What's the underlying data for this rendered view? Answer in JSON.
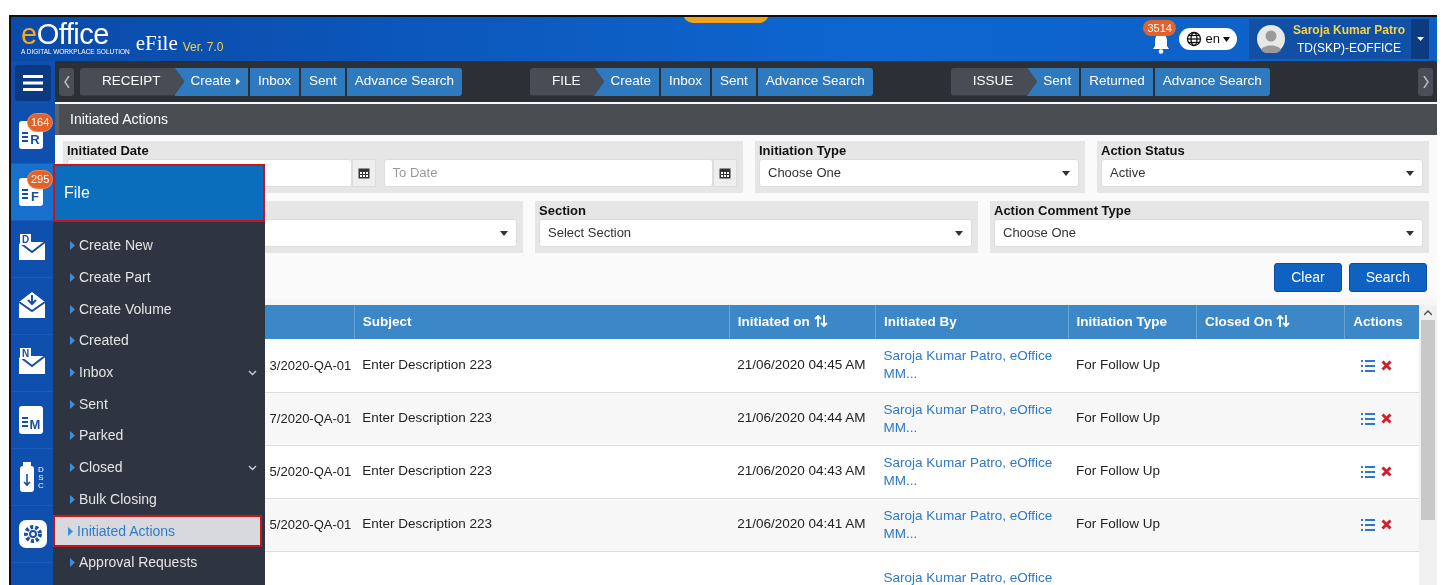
{
  "header": {
    "logo": "eOffice",
    "tagline": "A DIGITAL WORKPLACE SOLUTION",
    "app": "eFile",
    "version": "Ver. 7.0",
    "notification_count": "3514",
    "language": "en",
    "user": {
      "name": "Saroja Kumar Patro",
      "role": "TD(SKP)-EOFFICE"
    }
  },
  "rail": [
    {
      "kind": "doc",
      "glyph": "R",
      "badge": "164",
      "selected": false
    },
    {
      "kind": "doc",
      "glyph": "F",
      "badge": "295",
      "selected": true
    },
    {
      "kind": "mail",
      "glyph": "D",
      "selected": false
    },
    {
      "kind": "envelope",
      "selected": false
    },
    {
      "kind": "mail",
      "glyph": "N",
      "selected": false
    },
    {
      "kind": "doc",
      "glyph": "M",
      "selected": false
    },
    {
      "kind": "dsc",
      "glyph": "DSC",
      "selected": false
    },
    {
      "kind": "gear",
      "selected": false
    }
  ],
  "toolbar": [
    {
      "title": "RECEIPT",
      "links": [
        {
          "label": "Create",
          "submenu": true
        },
        {
          "label": "Inbox",
          "submenu": false
        },
        {
          "label": "Sent",
          "submenu": false
        },
        {
          "label": "Advance Search",
          "submenu": false
        }
      ]
    },
    {
      "title": "FILE",
      "links": [
        {
          "label": "Create",
          "submenu": false
        },
        {
          "label": "Inbox",
          "submenu": false
        },
        {
          "label": "Sent",
          "submenu": false
        },
        {
          "label": "Advance Search",
          "submenu": false
        }
      ]
    },
    {
      "title": "ISSUE",
      "links": [
        {
          "label": "Sent",
          "submenu": false
        },
        {
          "label": "Returned",
          "submenu": false
        },
        {
          "label": "Advance Search",
          "submenu": false
        }
      ]
    }
  ],
  "page_title": "Initiated Actions",
  "filters": [
    [
      {
        "kind": "date-range",
        "label": "Initiated Date",
        "to_placeholder": "To Date"
      },
      {
        "kind": "select",
        "label": "Initiation Type",
        "value": "Choose One"
      },
      {
        "kind": "select",
        "label": "Action Status",
        "value": "Active"
      }
    ],
    [
      {
        "kind": "select"
      },
      {
        "kind": "select",
        "label": "Section",
        "value": "Select Section"
      },
      {
        "kind": "select",
        "label": "Action Comment Type",
        "value": "Choose One"
      }
    ]
  ],
  "buttons": [
    "Clear",
    "Search"
  ],
  "table": {
    "columns": [
      {
        "sortable": false
      },
      {
        "label": "Subject",
        "sortable": false
      },
      {
        "label": "Initiated on",
        "sortable": true
      },
      {
        "label": "Initiated By",
        "sortable": false
      },
      {
        "label": "Initiation Type",
        "sortable": false
      },
      {
        "label": "Closed On",
        "sortable": true
      },
      {
        "label": "Actions",
        "sortable": false
      }
    ],
    "rows": [
      {
        "file_number": "3/2020-QA-01",
        "subject": "Enter Description 223",
        "initiated_on": "21/06/2020 04:45 AM",
        "initiated_by": "Saroja Kumar Patro, eOffice MM...",
        "initiation_type": "For Follow Up"
      },
      {
        "file_number": "7/2020-QA-01",
        "subject": "Enter Description 223",
        "initiated_on": "21/06/2020 04:44 AM",
        "initiated_by": "Saroja Kumar Patro, eOffice MM...",
        "initiation_type": "For Follow Up"
      },
      {
        "file_number": "5/2020-QA-01",
        "subject": "Enter Description 223",
        "initiated_on": "21/06/2020 04:43 AM",
        "initiated_by": "Saroja Kumar Patro, eOffice MM...",
        "initiation_type": "For Follow Up"
      },
      {
        "file_number": "5/2020-QA-01",
        "subject": "Enter Description 223",
        "initiated_on": "21/06/2020 04:41 AM",
        "initiated_by": "Saroja Kumar Patro, eOffice MM...",
        "initiation_type": "For Follow Up"
      },
      {
        "initiated_by": "Saroja Kumar Patro, eOffice"
      }
    ]
  },
  "menu": {
    "title": "File",
    "items": [
      {
        "label": "Create New",
        "expandable": false,
        "selected": false
      },
      {
        "label": "Create Part",
        "expandable": false,
        "selected": false
      },
      {
        "label": "Create Volume",
        "expandable": false,
        "selected": false
      },
      {
        "label": "Created",
        "expandable": false,
        "selected": false
      },
      {
        "label": "Inbox",
        "expandable": true,
        "selected": false
      },
      {
        "label": "Sent",
        "expandable": false,
        "selected": false
      },
      {
        "label": "Parked",
        "expandable": false,
        "selected": false
      },
      {
        "label": "Closed",
        "expandable": true,
        "selected": false
      },
      {
        "label": "Bulk Closing",
        "expandable": false,
        "selected": false
      },
      {
        "label": "Initiated Actions",
        "expandable": false,
        "selected": true
      },
      {
        "label": "Approval Requests",
        "expandable": false,
        "selected": false
      }
    ]
  }
}
